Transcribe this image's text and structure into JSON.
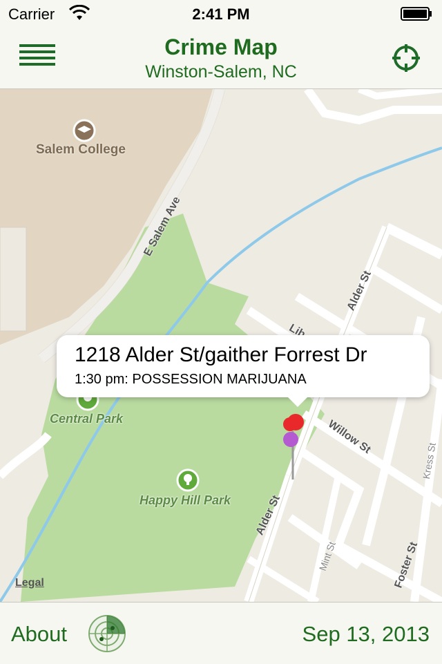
{
  "status_bar": {
    "carrier": "Carrier",
    "time": "2:41 PM"
  },
  "header": {
    "title": "Crime Map",
    "subtitle": "Winston-Salem, NC"
  },
  "map": {
    "poi": [
      {
        "name": "Salem College",
        "icon": "graduation-cap-icon"
      },
      {
        "name": "Central Park",
        "icon": "tree-icon"
      },
      {
        "name": "Happy Hill Park",
        "icon": "tree-icon"
      }
    ],
    "streets": {
      "e_salem_ave": "E Salem Ave",
      "alder_st_north": "Alder St",
      "alder_st_south": "Alder St",
      "willow_st": "Willow St",
      "mint_st": "Mint St",
      "foster_st": "Foster St",
      "kress_st": "Kress St",
      "lib": "Lib"
    },
    "legal": "Legal",
    "pin_colors": [
      "#e8282a",
      "#b45bd1"
    ]
  },
  "callout": {
    "title": "1218 Alder St/gaither Forrest Dr",
    "subtitle": "1:30 pm: POSSESSION MARIJUANA"
  },
  "footer": {
    "about": "About",
    "date": "Sep 13, 2013",
    "radar_icon": "radar-icon"
  },
  "colors": {
    "accent": "#1f6b1f",
    "park": "#b9dba0"
  }
}
